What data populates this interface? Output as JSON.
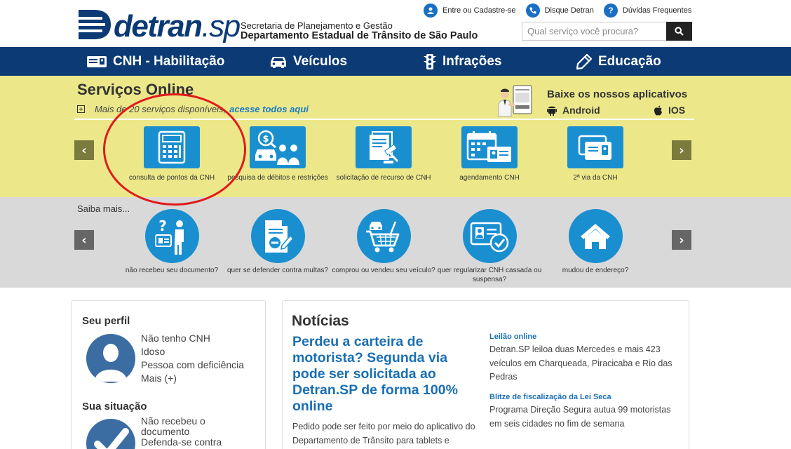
{
  "header": {
    "logo_text": "detran",
    "logo_suffix": ".sp",
    "org_line1": "Secretaria de Planejamento e Gestão",
    "org_line2": "Departamento Estadual de Trânsito de São Paulo",
    "links": [
      {
        "label": "Entre ou Cadastre-se",
        "icon": "user-icon"
      },
      {
        "label": "Disque Detran",
        "icon": "phone-icon"
      },
      {
        "label": "Dúvidas Frequentes",
        "icon": "help-icon"
      }
    ],
    "search_placeholder": "Qual serviço você procura?"
  },
  "nav": [
    {
      "label": "CNH - Habilitação",
      "icon": "license-card-icon"
    },
    {
      "label": "Veículos",
      "icon": "car-icon"
    },
    {
      "label": "Infrações",
      "icon": "traffic-light-icon"
    },
    {
      "label": "Educação",
      "icon": "pencil-icon"
    }
  ],
  "servicos": {
    "title": "Serviços Online",
    "subtitle": "Mais de 20 serviços disponíveis,",
    "link": "acesse todos aqui",
    "apps_title": "Baixe os nossos aplicativos",
    "android": "Android",
    "ios": "IOS",
    "items": [
      {
        "label": "consulta de pontos da CNH",
        "icon": "calculator-icon"
      },
      {
        "label": "pesquisa de débitos e restrições",
        "icon": "debt-search-icon"
      },
      {
        "label": "solicitação de recurso de CNH",
        "icon": "gavel-document-icon"
      },
      {
        "label": "agendamento CNH",
        "icon": "calendar-id-icon"
      },
      {
        "label": "2ª via da CNH",
        "icon": "duplicate-card-icon"
      }
    ]
  },
  "saiba": {
    "title": "Saiba mais...",
    "items": [
      {
        "label": "não recebeu seu documento?",
        "icon": "question-person-icon"
      },
      {
        "label": "quer se defender contra multas?",
        "icon": "document-edit-icon"
      },
      {
        "label": "comprou ou vendeu seu veículo?",
        "icon": "car-cart-icon"
      },
      {
        "label": "quer regularizar CNH cassada ou suspensa?",
        "icon": "id-check-icon"
      },
      {
        "label": "mudou de endereço?",
        "icon": "house-icon"
      }
    ]
  },
  "perfil": {
    "title": "Seu perfil",
    "items": [
      "Não tenho CNH",
      "Idoso",
      "Pessoa com deficiência",
      "Mais (+)"
    ],
    "situacao_title": "Sua situação",
    "situacao_items": [
      "Não recebeu o documento",
      "Defenda-se contra"
    ]
  },
  "noticias": {
    "title": "Notícias",
    "headline": "Perdeu a carteira de motorista? Segunda via pode ser solicitada ao Detran.SP de forma 100% online",
    "body": "Pedido pode ser feito por meio do aplicativo do Departamento de Trânsito para tablets e",
    "side": [
      {
        "title": "Leilão online",
        "body": "Detran.SP leiloa duas Mercedes e mais 423 veículos em Charqueada, Piracicaba e Rio das Pedras"
      },
      {
        "title": "Blitze de fiscalização da Lei Seca",
        "body": "Programa Direção Segura autua 99 motoristas em seis cidades no fim de semana"
      }
    ]
  },
  "colors": {
    "brand_navy": "#0b3a75",
    "accent_blue": "#1a8fd0",
    "yellow_band": "#ece88a",
    "gray_band": "#d9d9d9",
    "highlight_red": "#e01b1b"
  }
}
